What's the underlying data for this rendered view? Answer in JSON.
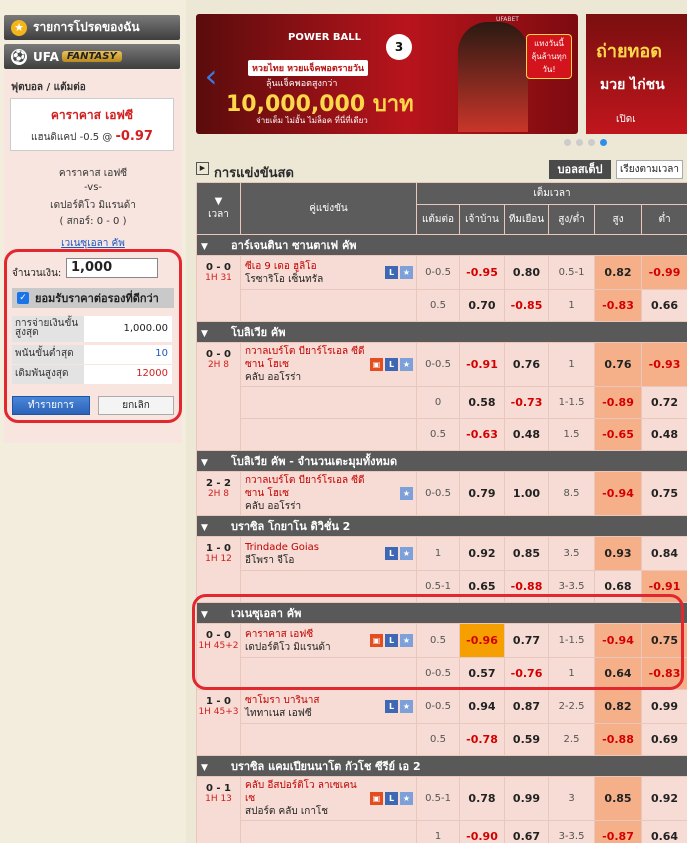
{
  "nav": {
    "favorites": "รายการโปรดของฉัน",
    "fantasy_prefix": "UFA",
    "fantasy": "FANTASY"
  },
  "betslip": {
    "sport": "ฟุตบอล / แต้มต่อ",
    "team": "คาราคาส เอฟซี",
    "hcp_label": "แฮนดิแคป",
    "hcp": "-0.5",
    "at": "@",
    "odds": "-0.97",
    "home": "คาราคาส เอฟซี",
    "vs": "-vs-",
    "away": "เดปอร์ติโว มิแรนด้า",
    "score": "( สกอร์: 0 - 0 )",
    "league": "เวเนซุเอลา คัพ",
    "amount_label": "จำนวนเงิน:",
    "amount": "1,000",
    "accept": "ยอมรับราคาต่อรองที่ดีกว่า",
    "payout_label": "การจ่ายเงินขั้นสูงสุด",
    "payout": "1,000.00",
    "min_label": "พนันขั้นต่ำสุด",
    "min": "10",
    "max_label": "เดิมพันสูงสุด",
    "max": "12000",
    "ok": "ทำรายการ",
    "cancel": "ยกเลิก"
  },
  "banner": {
    "brand": "UFABET",
    "logo": "POWER BALL",
    "line1": "หวยไทย หวยแจ็คพอตรายวัน",
    "line2": "ลุ้นแจ็คพอตสูงกว่า",
    "amount": "10,000,000 บาท",
    "line3": "จ่ายเต็ม ไม่อั้น ไม่ล็อค ที่นี่ที่เดียว",
    "bubble": "แทงวันนี้ ลุ้นล้านทุกวัน!",
    "side1": "ถ่ายทอด",
    "side2": "มวย ไก่ชน",
    "side3": "เปิดเ"
  },
  "header": {
    "title": "การแข่งขันสด",
    "tab_full": "บอลสเต็ป",
    "tab_follow": "เรียงตามเวลา"
  },
  "columns": {
    "time": "เวลา",
    "match": "คู่แข่งขัน",
    "fulltime": "เต็มเวลา",
    "hcp": "แต้มต่อ",
    "home": "เจ้าบ้าน",
    "away": "ทีมเยือน",
    "ou": "สูง/ต่ำ",
    "over": "สูง",
    "under": "ต่ำ"
  },
  "leagues": [
    {
      "name": "อาร์เจนตินา ซานตาเฟ คัพ",
      "matches": [
        {
          "score": "0 - 0",
          "time": "1H 31",
          "home": "ซีเอ 9 เดอ ฮูลิโอ",
          "away": "โรซาริโอ เซ็นทรัล",
          "icons": [
            "L",
            "S"
          ],
          "lines": [
            [
              "0-0.5",
              "-0.95",
              "0.80",
              "0.5-1",
              "0.82",
              "-0.99"
            ],
            [
              "0.5",
              "0.70",
              "-0.85",
              "1",
              "-0.83",
              "0.66"
            ]
          ]
        }
      ]
    },
    {
      "name": "โบลิเวีย คัพ",
      "matches": [
        {
          "score": "0 - 0",
          "time": "2H 8",
          "home": "กวาลเบร์โต บียาร์โรเอล ซีดี ซาน โฮเซ",
          "away": "คลับ ออโรร่า",
          "icons": [
            "T",
            "L",
            "S"
          ],
          "lines": [
            [
              "0-0.5",
              "-0.91",
              "0.76",
              "1",
              "0.76",
              "-0.93"
            ],
            [
              "0",
              "0.58",
              "-0.73",
              "1-1.5",
              "-0.89",
              "0.72"
            ],
            [
              "0.5",
              "-0.63",
              "0.48",
              "1.5",
              "-0.65",
              "0.48"
            ]
          ]
        }
      ]
    },
    {
      "name": "โบลิเวีย คัพ - จำนวนเตะมุมทั้งหมด",
      "matches": [
        {
          "score": "2 - 2",
          "time": "2H 8",
          "home": "กวาลเบร์โต บียาร์โรเอล ซีดี ซาน โฮเซ",
          "away": "คลับ ออโรร่า",
          "icons": [
            "S"
          ],
          "lines": [
            [
              "0-0.5",
              "0.79",
              "1.00",
              "8.5",
              "-0.94",
              "0.75"
            ]
          ]
        }
      ]
    },
    {
      "name": "บราซิล โกยาโน ดิวิชั่น 2",
      "matches": [
        {
          "score": "1 - 0",
          "time": "1H 12",
          "home": "Trindade Goias",
          "away": "อีโพรา จีโอ",
          "icons": [
            "L",
            "S"
          ],
          "lines": [
            [
              "1",
              "0.92",
              "0.85",
              "3.5",
              "0.93",
              "0.84"
            ],
            [
              "0.5-1",
              "0.65",
              "-0.88",
              "3-3.5",
              "0.68",
              "-0.91"
            ]
          ]
        }
      ]
    },
    {
      "name": "เวเนซุเอลา คัพ",
      "matches": [
        {
          "score": "0 - 0",
          "time": "1H 45+2",
          "home": "คาราคาส เอฟซี",
          "away": "เดปอร์ติโว มิแรนด้า",
          "icons": [
            "T",
            "L",
            "S"
          ],
          "lines": [
            [
              "0.5",
              "-0.96",
              "0.77",
              "1-1.5",
              "-0.94",
              "0.75"
            ],
            [
              "0-0.5",
              "0.57",
              "-0.76",
              "1",
              "0.64",
              "-0.83"
            ]
          ]
        },
        {
          "score": "1 - 0",
          "time": "1H 45+3",
          "home": "ซาโมรา บารินาส",
          "away": "ไททาเนส เอฟซี",
          "icons": [
            "L",
            "S"
          ],
          "lines": [
            [
              "0-0.5",
              "0.94",
              "0.87",
              "2-2.5",
              "0.82",
              "0.99"
            ],
            [
              "0.5",
              "-0.78",
              "0.59",
              "2.5",
              "-0.88",
              "0.69"
            ]
          ]
        }
      ]
    },
    {
      "name": "บราซิล แคมเปียนนาโต กัวโช ซีรีย์ เอ 2",
      "matches": [
        {
          "score": "0 - 1",
          "time": "1H 13",
          "home": "คลับ อีสปอร์ติโว ลาเซเคนเซ",
          "away": "สปอร์ต คลับ เกาโช",
          "icons": [
            "T",
            "L",
            "S"
          ],
          "lines": [
            [
              "0.5-1",
              "0.78",
              "0.99",
              "3",
              "0.85",
              "0.92"
            ],
            [
              "1",
              "-0.90",
              "0.67",
              "3-3.5",
              "-0.87",
              "0.64"
            ]
          ]
        }
      ]
    }
  ]
}
